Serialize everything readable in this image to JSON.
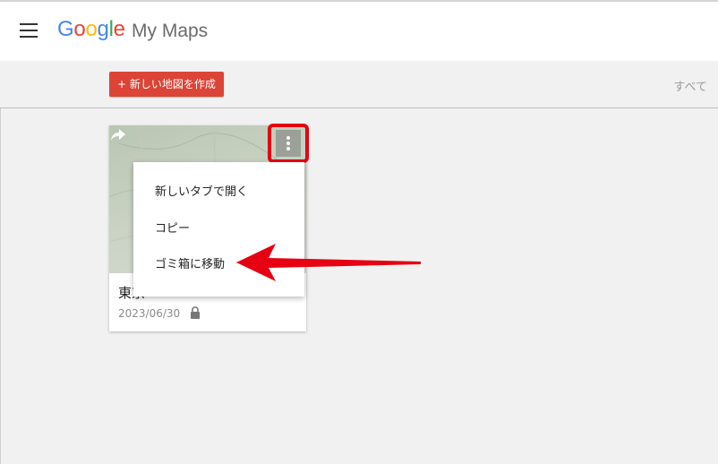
{
  "header": {
    "logo_letters": [
      "G",
      "o",
      "o",
      "g",
      "l",
      "e"
    ],
    "product_name": "My Maps"
  },
  "toolbar": {
    "create_label": "+ 新しい地図を作成",
    "filter_label": "すべて"
  },
  "map_card": {
    "title": "東京",
    "date": "2023/06/30"
  },
  "context_menu": {
    "items": [
      "新しいタブで開く",
      "コピー",
      "ゴミ箱に移動"
    ]
  },
  "colors": {
    "create_button": "#db4437",
    "highlight": "#e60012",
    "arrow": "#e60012"
  },
  "icons": {
    "menu": "hamburger-icon",
    "share": "share-icon",
    "more": "more-vert-icon",
    "lock": "lock-icon"
  }
}
